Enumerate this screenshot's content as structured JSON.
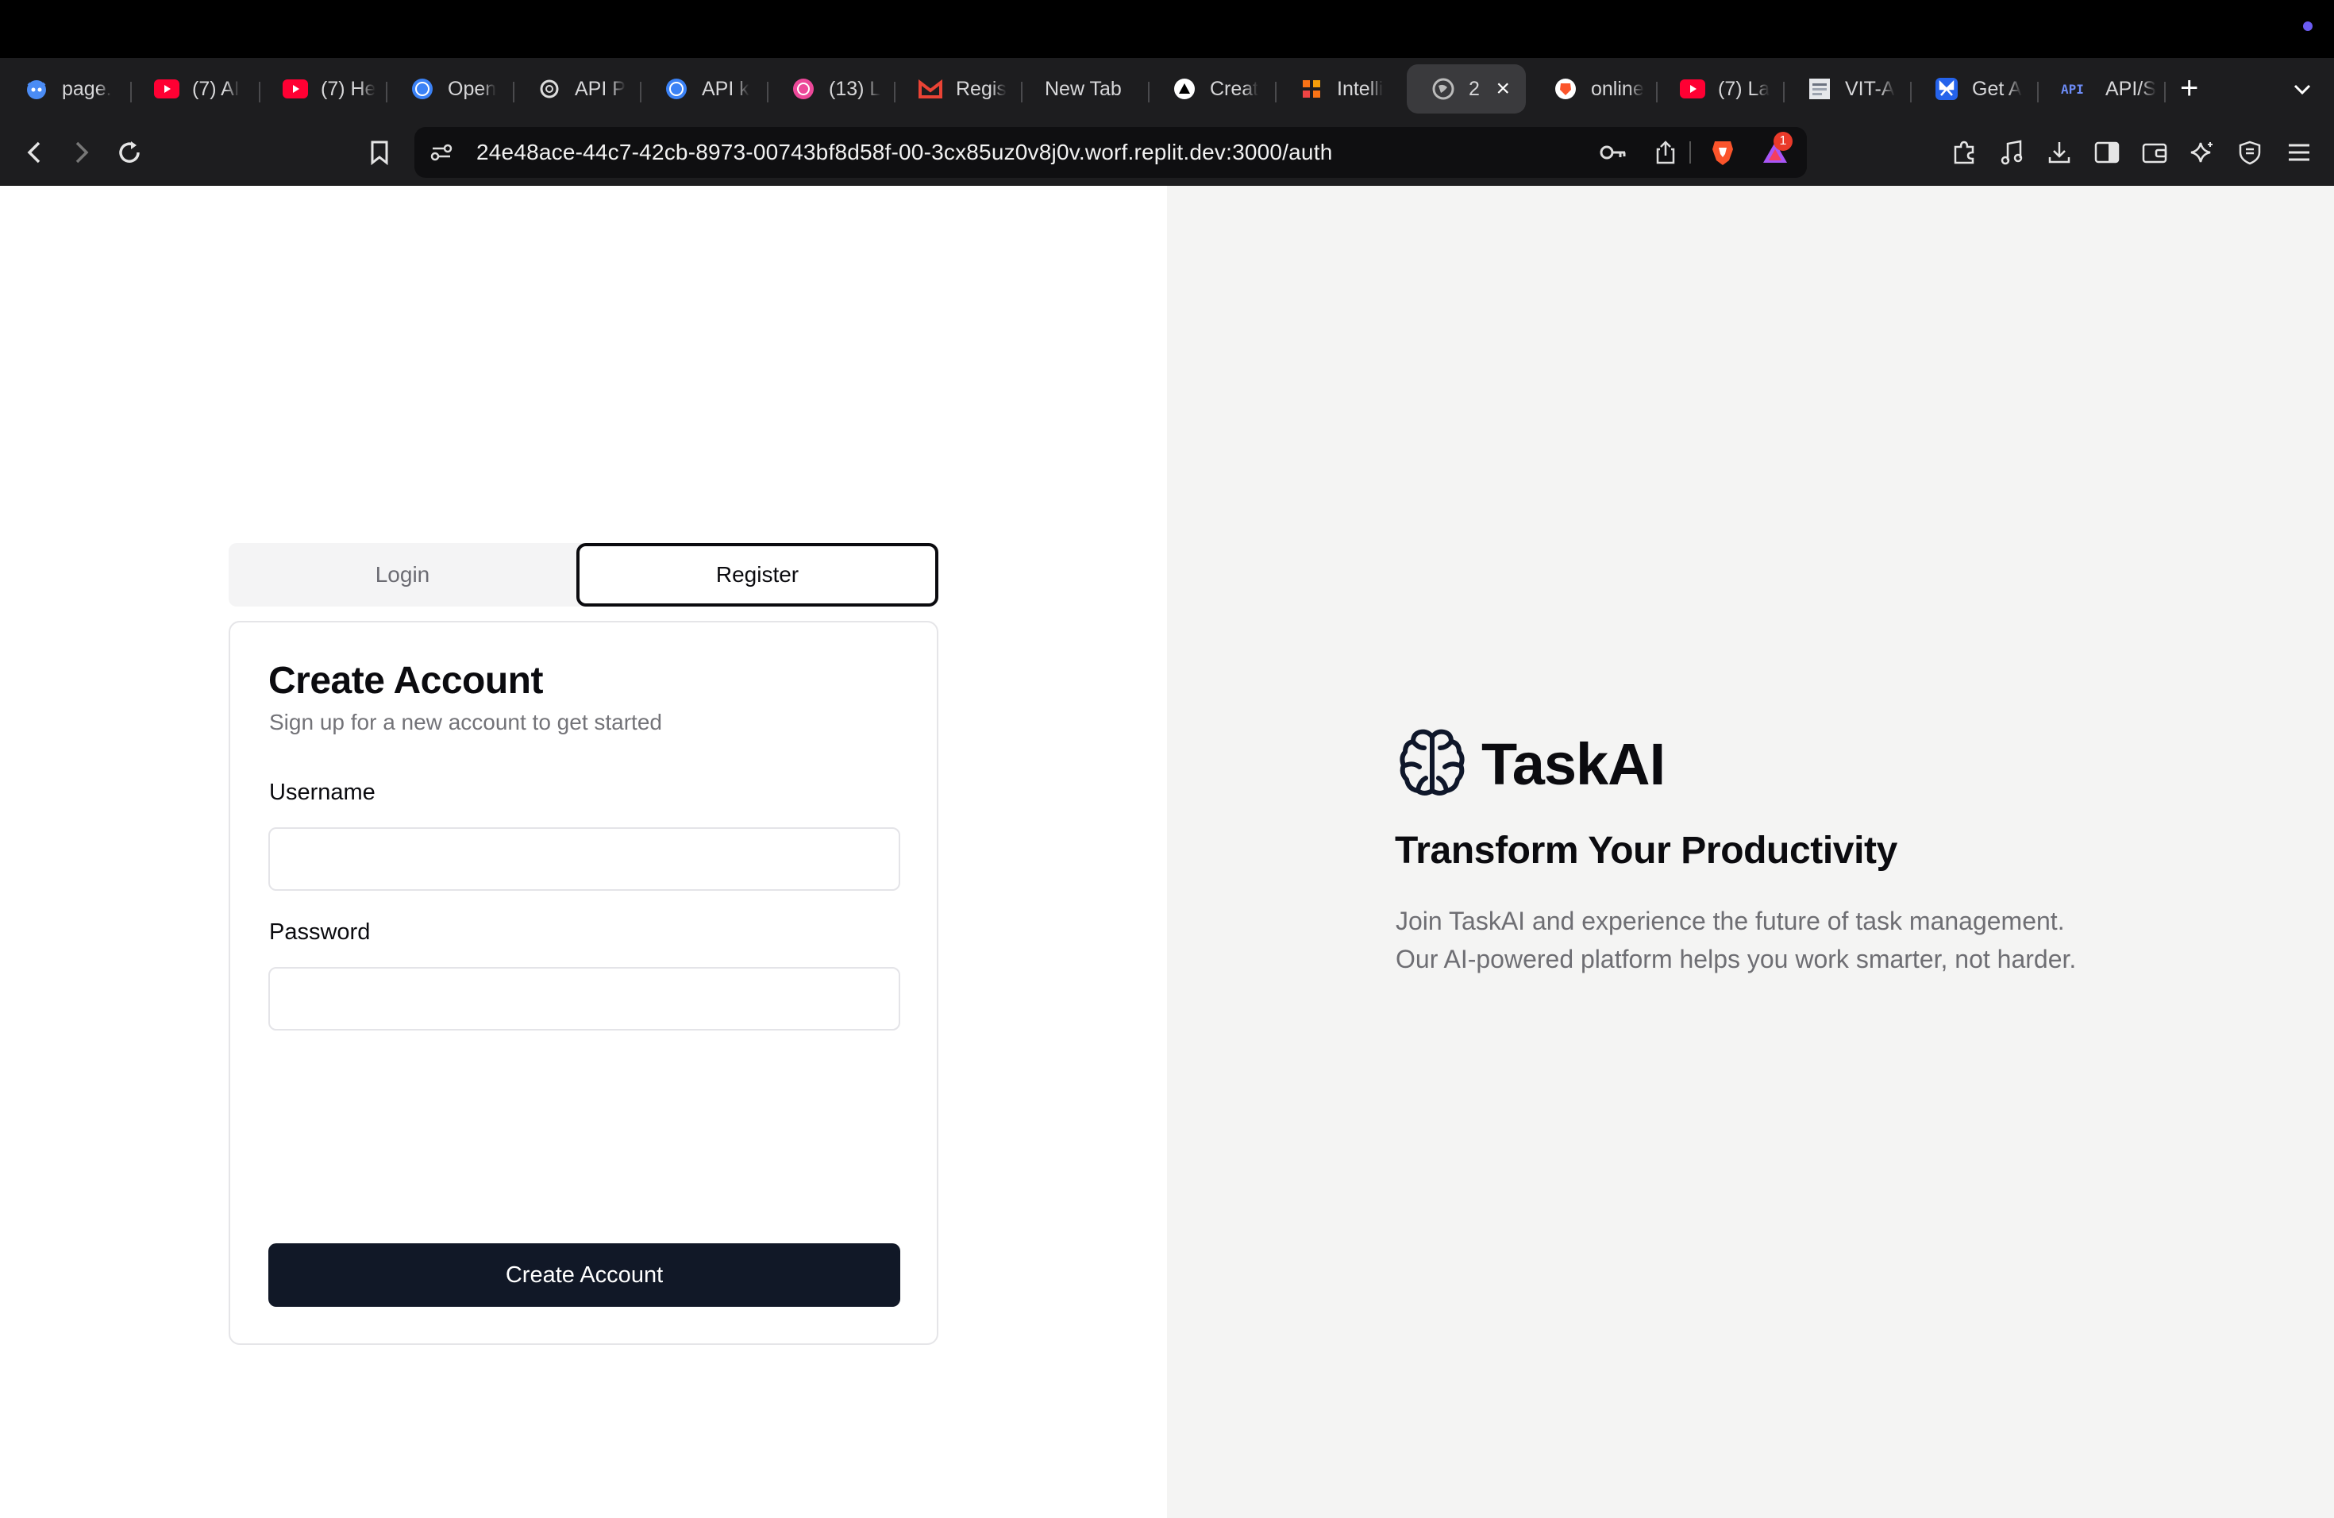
{
  "browser": {
    "tabs": [
      {
        "title": "page.",
        "icon": "github-icon"
      },
      {
        "title": "(7) AI",
        "icon": "youtube-icon"
      },
      {
        "title": "(7) He",
        "icon": "youtube-icon"
      },
      {
        "title": "Open",
        "icon": "globe-icon"
      },
      {
        "title": "API P",
        "icon": "openai-icon"
      },
      {
        "title": "API k",
        "icon": "globe-icon"
      },
      {
        "title": "(13) L",
        "icon": "circle-icon"
      },
      {
        "title": "Regis",
        "icon": "gmail-icon"
      },
      {
        "title": "New Tab",
        "icon": ""
      },
      {
        "title": "Creat",
        "icon": "triangle-icon"
      },
      {
        "title": "Intelli",
        "icon": "grid-icon"
      },
      {
        "title": "2",
        "icon": "globe-icon",
        "active": true
      },
      {
        "title": "online",
        "icon": "brave-icon"
      },
      {
        "title": "(7) La",
        "icon": "youtube-icon"
      },
      {
        "title": "VIT-A",
        "icon": "page-icon"
      },
      {
        "title": "Get A",
        "icon": "butterfly-icon"
      },
      {
        "title": "API/S",
        "icon": "api-icon"
      }
    ],
    "url": "24e48ace-44c7-42cb-8973-00743bf8d58f-00-3cx85uz0v8j0v.worf.replit.dev:3000/auth",
    "notification_count": "1",
    "colors": {
      "brave": "#fb542b",
      "youtube": "#ff0033",
      "accent": "#6b5cf2"
    }
  },
  "auth": {
    "tab_login": "Login",
    "tab_register": "Register",
    "card_title": "Create Account",
    "card_subtitle": "Sign up for a new account to get started",
    "username_label": "Username",
    "username_value": "",
    "password_label": "Password",
    "password_value": "",
    "submit_label": "Create Account"
  },
  "hero": {
    "brand": "TaskAI",
    "headline": "Transform Your Productivity",
    "description_line1": "Join TaskAI and experience the future of task management.",
    "description_line2": "Our AI-powered platform helps you work smarter, not harder."
  }
}
